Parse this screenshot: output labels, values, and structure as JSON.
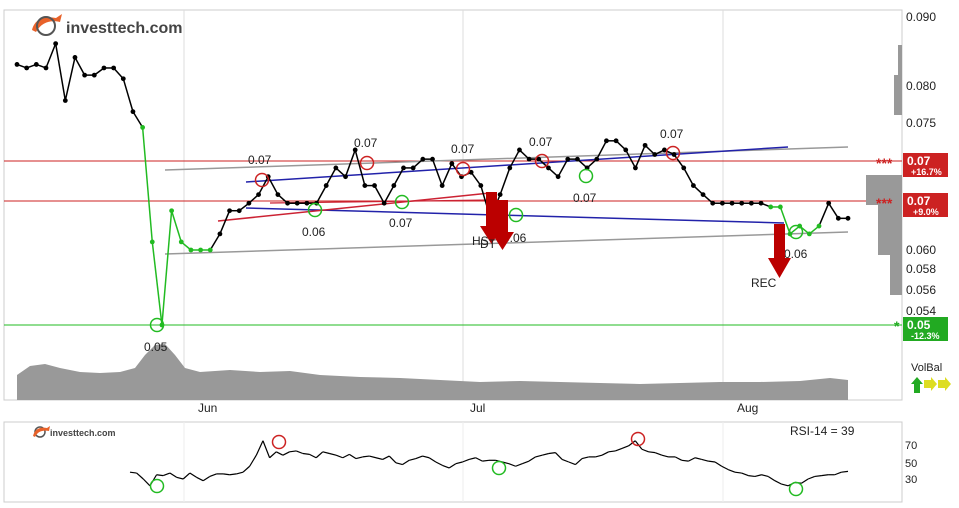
{
  "brand": {
    "name": "investtech.com",
    "name_small": "investtech.com"
  },
  "colors": {
    "price_line": "#000000",
    "up_segment": "#22bb22",
    "resistance": "#cc2222",
    "support": "#22aa22",
    "trend_blue": "#2222aa",
    "trend_gray": "#999999",
    "trend_red": "#cc2233",
    "volume": "#999999",
    "arrow": "#bb0000"
  },
  "volbal": {
    "label": "VolBal"
  },
  "chart_data": [
    {
      "type": "line",
      "name": "price",
      "ylim": [
        0.0495,
        0.0915
      ],
      "y_scale": "log",
      "x_ticks": [
        "Jun",
        "Jul",
        "Aug"
      ],
      "y_ticks": [
        "0.090",
        "0.080",
        "0.075",
        "0.060",
        "0.058",
        "0.056",
        "0.054"
      ],
      "x": [
        0,
        1,
        2,
        3,
        4,
        5,
        6,
        7,
        8,
        9,
        10,
        11,
        12,
        13,
        14,
        15,
        16,
        17,
        18,
        19,
        20,
        21,
        22,
        23,
        24,
        25,
        26,
        27,
        28,
        29,
        30,
        31,
        32,
        33,
        34,
        35,
        36,
        37,
        38,
        39,
        40,
        41,
        42,
        43,
        44,
        45,
        46,
        47,
        48,
        49,
        50,
        51,
        52,
        53,
        54,
        55,
        56,
        57,
        58,
        59,
        60,
        61,
        62,
        63,
        64,
        65,
        66,
        67,
        68,
        69,
        70,
        71,
        72,
        73,
        74,
        75,
        76,
        77,
        78,
        79,
        80,
        81,
        82,
        83,
        84,
        85,
        86,
        87,
        88,
        89,
        90,
        91,
        92,
        93,
        94,
        95,
        96,
        97,
        98,
        99
      ],
      "values": [
        0.083,
        0.0825,
        0.083,
        0.0825,
        0.086,
        0.078,
        0.084,
        0.0815,
        0.0815,
        0.0825,
        0.0825,
        0.081,
        0.0765,
        0.0745,
        0.061,
        0.05,
        0.065,
        0.061,
        0.06,
        0.06,
        0.06,
        0.062,
        0.065,
        0.065,
        0.066,
        0.067,
        0.069,
        0.067,
        0.066,
        0.066,
        0.066,
        0.066,
        0.068,
        0.07,
        0.069,
        0.072,
        0.068,
        0.068,
        0.066,
        0.068,
        0.07,
        0.07,
        0.071,
        0.071,
        0.068,
        0.0705,
        0.069,
        0.0695,
        0.068,
        0.064,
        0.067,
        0.07,
        0.072,
        0.071,
        0.071,
        0.07,
        0.069,
        0.071,
        0.071,
        0.07,
        0.071,
        0.073,
        0.073,
        0.072,
        0.07,
        0.0725,
        0.0715,
        0.072,
        0.0715,
        0.07,
        0.068,
        0.067,
        0.066,
        0.066,
        0.066,
        0.066,
        0.066,
        0.066,
        0.0655,
        0.0655,
        0.062,
        0.063,
        0.062,
        0.063,
        0.066,
        0.064,
        0.064
      ],
      "annotations": [
        {
          "text": "0.07"
        },
        {
          "text": "0.07"
        },
        {
          "text": "0.07"
        },
        {
          "text": "0.07"
        },
        {
          "text": "0.07"
        },
        {
          "text": "0.06"
        },
        {
          "text": "0.07"
        },
        {
          "text": "0.06"
        },
        {
          "text": "0.07"
        },
        {
          "text": "0.06"
        },
        {
          "text": "0.05"
        },
        {
          "text": "HS"
        },
        {
          "text": "DT"
        },
        {
          "text": "REC"
        }
      ],
      "levels": [
        {
          "stars": "***",
          "value": "0.07",
          "pct": "+16.7%",
          "price": 0.0708,
          "color": "#cc2222"
        },
        {
          "stars": "***",
          "value": "0.07",
          "pct": "+9.0%",
          "price": 0.0663,
          "color": "#cc2222"
        },
        {
          "stars": "*",
          "value": "0.05",
          "pct": "-12.3%",
          "price": 0.05,
          "color": "#22aa22"
        }
      ]
    },
    {
      "type": "line",
      "name": "rsi",
      "label": "RSI-14 = 39",
      "ylim": [
        15,
        85
      ],
      "y_ticks": [
        "70",
        "50",
        "30"
      ],
      "values": [
        38,
        37,
        30,
        22,
        35,
        34,
        37,
        32,
        30,
        37,
        32,
        28,
        33,
        36,
        36,
        35,
        36,
        38,
        45,
        58,
        75,
        55,
        62,
        58,
        62,
        63,
        60,
        59,
        55,
        62,
        60,
        58,
        55,
        59,
        54,
        56,
        57,
        55,
        53,
        57,
        49,
        47,
        52,
        54,
        57,
        55,
        50,
        46,
        43,
        48,
        50,
        53,
        55,
        51,
        52,
        52,
        50,
        48,
        45,
        48,
        51,
        56,
        58,
        60,
        61,
        53,
        50,
        47,
        54,
        56,
        56,
        58,
        62,
        63,
        66,
        69,
        75,
        65,
        62,
        61,
        58,
        56,
        56,
        52,
        51,
        55,
        53,
        51,
        50,
        45,
        41,
        38,
        37,
        34,
        33,
        35,
        33,
        28,
        24,
        22,
        26,
        25,
        30,
        33,
        34,
        35,
        35,
        38,
        39
      ]
    }
  ]
}
